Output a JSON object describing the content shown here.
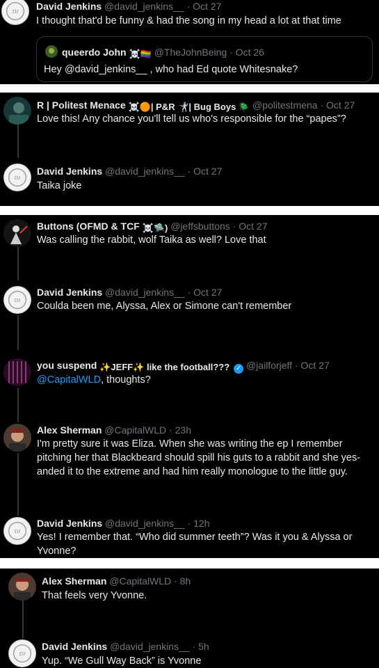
{
  "panels": [
    {
      "tweets": [
        {
          "name": "David Jenkins",
          "handle": "@david_jenkins__",
          "sep": "·",
          "time": "Oct 27",
          "text": "I thought that'd be funny & had the song in my head a lot at that time",
          "quote": {
            "name": "queerdo John",
            "emoji": "☠️🏳️‍🌈",
            "handle": "@TheJohnBeing",
            "sep": "·",
            "time": "Oct 26",
            "text": "Hey @david_jenkins__ , who had Ed quote Whitesnake?"
          }
        }
      ]
    },
    {
      "tweets": [
        {
          "name": "R | Politest Menace",
          "emoji": "☠️🟠| P&R 🤺| Bug Boys 🪲",
          "handle": "@politestmena",
          "sep": "·",
          "time": "Oct 27",
          "text": "Love this! Any chance you'll tell us who's responsible for the “papes”?"
        },
        {
          "name": "David Jenkins",
          "handle": "@david_jenkins__",
          "sep": "·",
          "time": "Oct 27",
          "text": "Taika joke"
        }
      ]
    },
    {
      "tweets": [
        {
          "name": "Buttons (OFMD & TCF",
          "emoji": "☠️🛸)",
          "handle": "@jeffsbuttons",
          "sep": "·",
          "time": "Oct 27",
          "text": "Was calling the rabbit, wolf Taika as well? Love that"
        },
        {
          "name": "David Jenkins",
          "handle": "@david_jenkins__",
          "sep": "·",
          "time": "Oct 27",
          "text": "Coulda been me, Alyssa, Alex or Simone can't remember"
        },
        {
          "name": "you suspend",
          "emoji": "✨JEFF✨ like the football???",
          "handle": "@jailforjeff",
          "sep": "·",
          "time": "Oct 27",
          "mention": "@CapitalWLD",
          "text": ", thoughts?"
        },
        {
          "name": "Alex Sherman",
          "handle": "@CapitalWLD",
          "sep": "·",
          "time": "23h",
          "text": "I'm pretty sure it was Eliza. When she was writing the ep I remember pitching her that Blackbeard should spill his guts to a rabbit and she yes-anded it to the extreme and had him really monologue to the little guy."
        },
        {
          "name": "David Jenkins",
          "handle": "@david_jenkins__",
          "sep": "·",
          "time": "12h",
          "text": "Yes! I remember that. “Who did summer teeth”? Was it you & Alyssa or Yvonne?"
        }
      ]
    },
    {
      "tweets": [
        {
          "name": "Alex Sherman",
          "handle": "@CapitalWLD",
          "sep": "·",
          "time": "8h",
          "text": "That feels very Yvonne."
        },
        {
          "name": "David Jenkins",
          "handle": "@david_jenkins__",
          "sep": "·",
          "time": "5h",
          "text": "Yup. “We Gull Way Back” is Yvonne"
        }
      ]
    }
  ]
}
